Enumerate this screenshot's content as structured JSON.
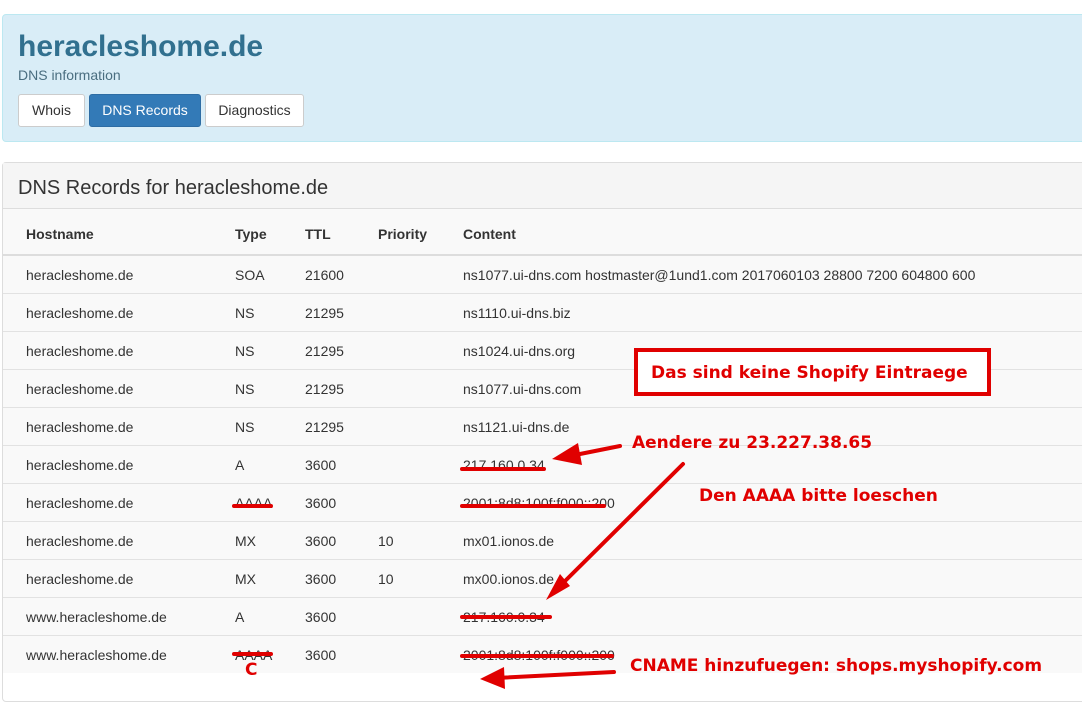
{
  "header": {
    "title": "heracleshome.de",
    "subtitle": "DNS information",
    "tabs": [
      {
        "label": "Whois",
        "active": false
      },
      {
        "label": "DNS Records",
        "active": true
      },
      {
        "label": "Diagnostics",
        "active": false
      }
    ],
    "colors": {
      "panel_bg": "#d9edf7",
      "title": "#31708f",
      "active_tab": "#337ab7"
    }
  },
  "records": {
    "title": "DNS Records for heracleshome.de",
    "columns": [
      "Hostname",
      "Type",
      "TTL",
      "Priority",
      "Content"
    ],
    "rows": [
      {
        "hostname": "heracleshome.de",
        "type": "SOA",
        "ttl": "21600",
        "priority": "",
        "content": "ns1077.ui-dns.com hostmaster@1und1.com 2017060103 28800 7200 604800 600"
      },
      {
        "hostname": "heracleshome.de",
        "type": "NS",
        "ttl": "21295",
        "priority": "",
        "content": "ns1110.ui-dns.biz"
      },
      {
        "hostname": "heracleshome.de",
        "type": "NS",
        "ttl": "21295",
        "priority": "",
        "content": "ns1024.ui-dns.org"
      },
      {
        "hostname": "heracleshome.de",
        "type": "NS",
        "ttl": "21295",
        "priority": "",
        "content": "ns1077.ui-dns.com"
      },
      {
        "hostname": "heracleshome.de",
        "type": "NS",
        "ttl": "21295",
        "priority": "",
        "content": "ns1121.ui-dns.de"
      },
      {
        "hostname": "heracleshome.de",
        "type": "A",
        "ttl": "3600",
        "priority": "",
        "content": "217.160.0.34"
      },
      {
        "hostname": "heracleshome.de",
        "type": "AAAA",
        "ttl": "3600",
        "priority": "",
        "content": "2001:8d8:100f:f000::200"
      },
      {
        "hostname": "heracleshome.de",
        "type": "MX",
        "ttl": "3600",
        "priority": "10",
        "content": "mx01.ionos.de"
      },
      {
        "hostname": "heracleshome.de",
        "type": "MX",
        "ttl": "3600",
        "priority": "10",
        "content": "mx00.ionos.de"
      },
      {
        "hostname": "www.heracleshome.de",
        "type": "A",
        "ttl": "3600",
        "priority": "",
        "content": "217.160.0.34"
      },
      {
        "hostname": "www.heracleshome.de",
        "type": "AAAA",
        "ttl": "3600",
        "priority": "",
        "content": "2001:8d8:100f:f000::200"
      }
    ]
  },
  "annotations": {
    "box_note": "Das sind keine Shopify Eintraege",
    "change_note": "Aendere zu 23.227.38.65",
    "delete_note": "Den AAAA bitte loeschen",
    "cname_note": "CNAME hinzufuegen: shops.myshopify.com",
    "c_mark": "C",
    "color": "#e00000"
  }
}
